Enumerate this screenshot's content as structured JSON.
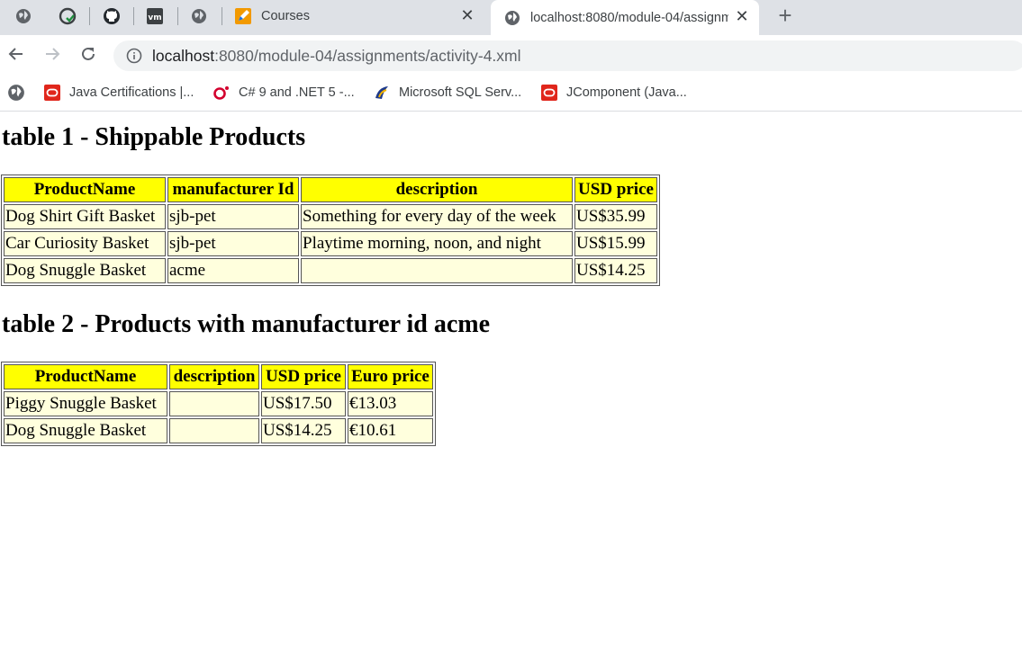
{
  "browser": {
    "tabs": [
      {
        "title": "Courses"
      },
      {
        "title": "localhost:8080/module-04/assignments/activity-4.xml"
      }
    ],
    "address": {
      "host": "localhost",
      "rest": ":8080/module-04/assignments/activity-4.xml"
    },
    "bookmarks": [
      {
        "label": "Java Certifications |..."
      },
      {
        "label": "C# 9 and .NET 5 -..."
      },
      {
        "label": "Microsoft SQL Serv..."
      },
      {
        "label": "JComponent (Java..."
      }
    ]
  },
  "page": {
    "table1": {
      "title": "table 1 - Shippable Products",
      "headers": [
        "ProductName",
        "manufacturer Id",
        "description",
        "USD price"
      ],
      "rows": [
        [
          "Dog Shirt Gift Basket",
          "sjb-pet",
          "Something for every day of the week",
          "US$35.99"
        ],
        [
          "Car Curiosity Basket",
          "sjb-pet",
          "Playtime morning, noon, and night",
          "US$15.99"
        ],
        [
          "Dog Snuggle Basket",
          "acme",
          "",
          "US$14.25"
        ]
      ]
    },
    "table2": {
      "title": "table 2 - Products with manufacturer id acme",
      "headers": [
        "ProductName",
        "description",
        "USD price",
        "Euro price"
      ],
      "rows": [
        [
          "Piggy Snuggle Basket",
          "",
          "US$17.50",
          "€13.03"
        ],
        [
          "Dog Snuggle Basket",
          "",
          "US$14.25",
          "€10.61"
        ]
      ]
    }
  }
}
